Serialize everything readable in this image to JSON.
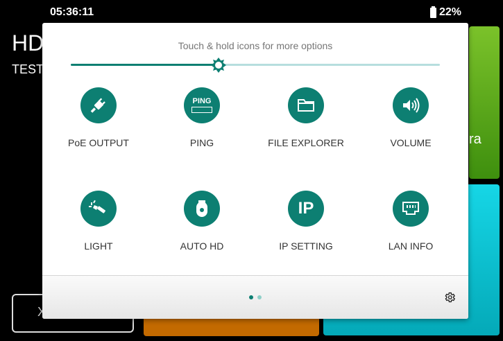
{
  "status": {
    "time": "05:36:11",
    "battery": "22%"
  },
  "background": {
    "title": "HD",
    "subtitle": "TEST",
    "green_tile_text": "ra",
    "outline_tile_text": "X"
  },
  "panel": {
    "hint": "Touch & hold icons for more options",
    "brightness_level": 0.4,
    "tiles": [
      {
        "label": "PoE OUTPUT",
        "icon": "plug-icon"
      },
      {
        "label": "PING",
        "icon": "ping-icon",
        "icon_text": "PING"
      },
      {
        "label": "FILE EXPLORER",
        "icon": "folder-icon"
      },
      {
        "label": "VOLUME",
        "icon": "speaker-icon"
      },
      {
        "label": "LIGHT",
        "icon": "flashlight-icon"
      },
      {
        "label": "AUTO HD",
        "icon": "dome-camera-icon"
      },
      {
        "label": "IP SETTING",
        "icon": "ip-icon",
        "icon_text": "IP"
      },
      {
        "label": "LAN INFO",
        "icon": "lan-port-icon"
      }
    ],
    "pages": {
      "count": 2,
      "current": 1
    }
  },
  "colors": {
    "accent": "#0d7f72",
    "track": "#b6dede",
    "dot_inactive": "#8fd0c8"
  }
}
